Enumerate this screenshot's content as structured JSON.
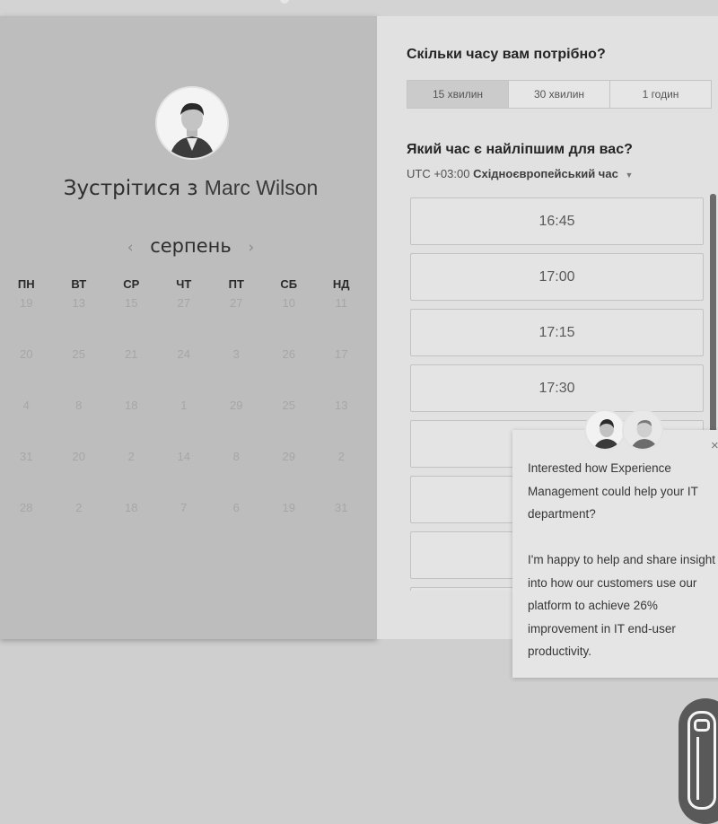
{
  "host": {
    "name_prefix": "Зустрітися з",
    "name": "Marc Wilson"
  },
  "calendar": {
    "month": "серпень",
    "prev_label": "‹",
    "next_label": "›",
    "weekdays": [
      "ПН",
      "ВТ",
      "СР",
      "ЧТ",
      "ПТ",
      "СБ",
      "НД"
    ],
    "rows": [
      [
        "19",
        "13",
        "15",
        "27",
        "27",
        "10",
        "11"
      ],
      [
        "20",
        "25",
        "21",
        "24",
        "3",
        "26",
        "17"
      ],
      [
        "4",
        "8",
        "18",
        "1",
        "29",
        "25",
        "13"
      ],
      [
        "31",
        "20",
        "2",
        "14",
        "8",
        "29",
        "2"
      ],
      [
        "28",
        "2",
        "18",
        "7",
        "6",
        "19",
        "31"
      ]
    ]
  },
  "booking": {
    "duration_question": "Скільки часу вам потрібно?",
    "durations": [
      "15 хвилин",
      "30 хвилин",
      "1 годин"
    ],
    "selected_duration": "15 хвилин",
    "time_question": "Який час є найліпшим для вас?",
    "timezone_offset": "UTC +03:00",
    "timezone_name": "Східноєвропейський час",
    "slots": [
      "16:45",
      "17:00",
      "17:15",
      "17:30",
      "",
      "",
      "",
      ""
    ]
  },
  "chat": {
    "message": "Interested how Experience Management could help your IT department?\n\nI'm happy to help and share insight into how our customers use our platform to achieve 26% improvement in IT end-user productivity.",
    "close_label": "×"
  },
  "colors": {
    "left_panel": "#bdbdbd",
    "right_panel": "#e1e1e1",
    "page_bg": "#cfcfcf",
    "launcher": "#595959"
  },
  "icons": {
    "prev": "chevron-left-icon",
    "next": "chevron-right-icon",
    "tz_caret": "caret-down-icon",
    "close": "close-icon",
    "launcher": "chat-launcher-icon"
  }
}
